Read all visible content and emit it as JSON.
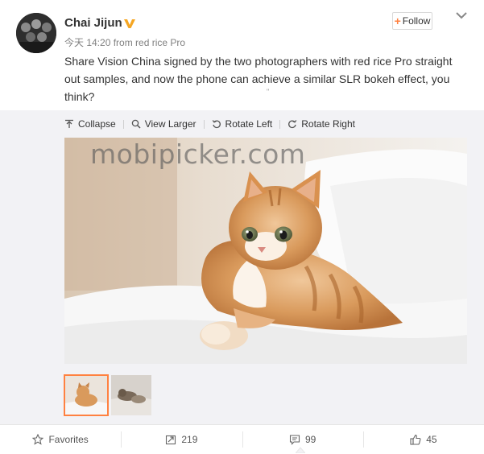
{
  "post": {
    "author": "Chai Jijun",
    "time_label": "今天 14:20",
    "source": "from red rice Pro",
    "follow_label": "Follow",
    "text": "Share Vision China signed by the two photographers with red rice Pro straight out samples, and now the phone can achieve a similar SLR bokeh effect, you think?",
    "tiny_mark": "\""
  },
  "media": {
    "toolbar": [
      {
        "icon": "collapse-icon",
        "label": "Collapse"
      },
      {
        "icon": "search-icon",
        "label": "View Larger"
      },
      {
        "icon": "rotate-left-icon",
        "label": "Rotate Left"
      },
      {
        "icon": "rotate-right-icon",
        "label": "Rotate Right"
      }
    ],
    "watermark": "mobipicker.com",
    "thumbnails_selected_index": 0
  },
  "footer": {
    "favorites_label": "Favorites",
    "reposts": "219",
    "comments": "99",
    "likes": "45"
  },
  "colors": {
    "accent": "#ff8140",
    "panel": "#f2f2f5",
    "verified": "#f5a623"
  }
}
